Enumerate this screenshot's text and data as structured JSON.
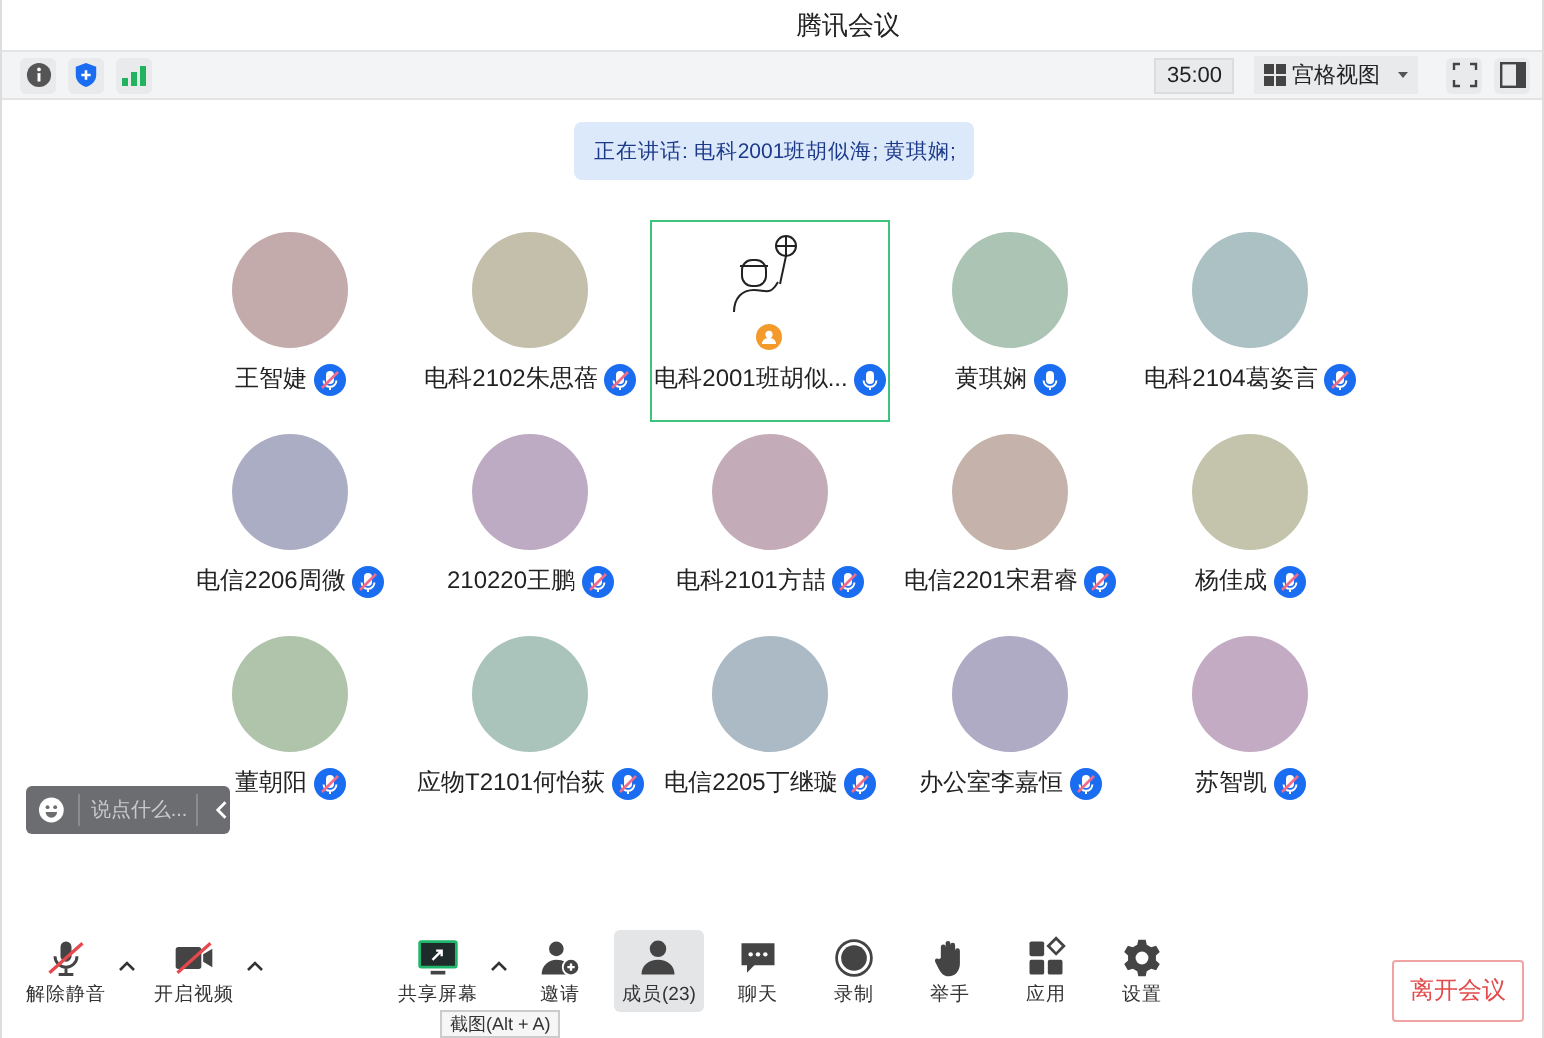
{
  "window": {
    "title": "腾讯会议"
  },
  "top_bar": {
    "timer": "35:00",
    "view_mode": "宫格视图"
  },
  "speaking_banner": "正在讲话: 电科2001班胡似海; 黄琪娴;",
  "participants": [
    {
      "name": "王智婕",
      "muted": true,
      "speaking": false,
      "host": false
    },
    {
      "name": "电科2102朱思蓓",
      "muted": true,
      "speaking": false,
      "host": false
    },
    {
      "name": "电科2001班胡似...",
      "muted": false,
      "speaking": true,
      "host": true
    },
    {
      "name": "黄琪娴",
      "muted": false,
      "speaking": false,
      "host": false
    },
    {
      "name": "电科2104葛姿言",
      "muted": true,
      "speaking": false,
      "host": false
    },
    {
      "name": "电信2206周微",
      "muted": true,
      "speaking": false,
      "host": false
    },
    {
      "name": "210220王鹏",
      "muted": true,
      "speaking": false,
      "host": false
    },
    {
      "name": "电科2101方喆",
      "muted": true,
      "speaking": false,
      "host": false
    },
    {
      "name": "电信2201宋君睿",
      "muted": true,
      "speaking": false,
      "host": false
    },
    {
      "name": "杨佳成",
      "muted": true,
      "speaking": false,
      "host": false
    },
    {
      "name": "董朝阳",
      "muted": true,
      "speaking": false,
      "host": false
    },
    {
      "name": "应物T2101何怡荻",
      "muted": true,
      "speaking": false,
      "host": false
    },
    {
      "name": "电信2205丁继璇",
      "muted": true,
      "speaking": false,
      "host": false
    },
    {
      "name": "办公室李嘉恒",
      "muted": true,
      "speaking": false,
      "host": false
    },
    {
      "name": "苏智凯",
      "muted": true,
      "speaking": false,
      "host": false
    }
  ],
  "chat_input": {
    "placeholder": "说点什么..."
  },
  "toolbar": [
    {
      "kind": "mic",
      "label": "解除静音",
      "off": true,
      "has_menu": true,
      "selected": false
    },
    {
      "kind": "video",
      "label": "开启视频",
      "off": true,
      "has_menu": true,
      "selected": false
    },
    {
      "kind": "share",
      "label": "共享屏幕",
      "has_menu": true,
      "selected": false
    },
    {
      "kind": "invite",
      "label": "邀请",
      "has_menu": false,
      "selected": false
    },
    {
      "kind": "members",
      "label": "成员(23)",
      "has_menu": false,
      "selected": true
    },
    {
      "kind": "chat",
      "label": "聊天",
      "has_menu": false,
      "selected": false
    },
    {
      "kind": "record",
      "label": "录制",
      "has_menu": false,
      "selected": false
    },
    {
      "kind": "hand",
      "label": "举手",
      "has_menu": false,
      "selected": false
    },
    {
      "kind": "apps",
      "label": "应用",
      "has_menu": false,
      "selected": false
    },
    {
      "kind": "settings",
      "label": "设置",
      "has_menu": false,
      "selected": false
    }
  ],
  "tooltip": "截图(Alt + A)",
  "leave_button": "离开会议"
}
